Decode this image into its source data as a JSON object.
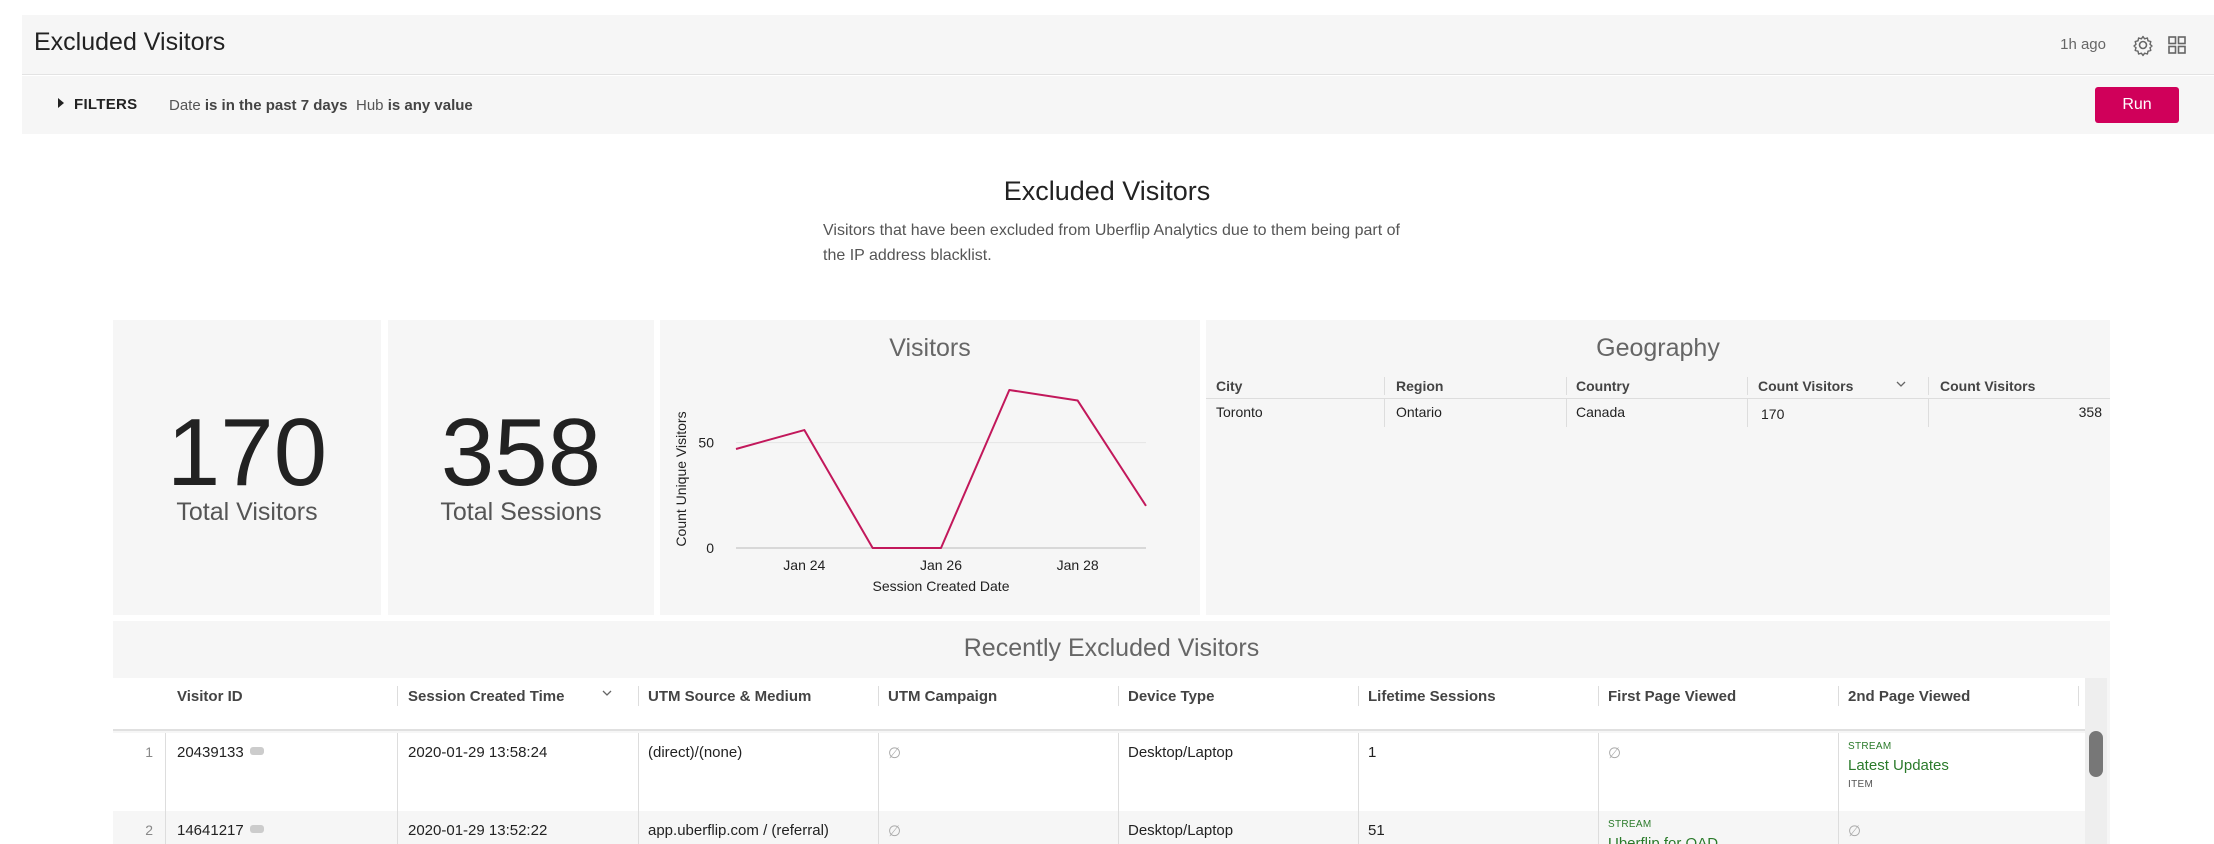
{
  "header": {
    "title": "Excluded Visitors",
    "last_updated": "1h ago",
    "icons": [
      "gear-icon",
      "grid-icon"
    ]
  },
  "filters": {
    "toggle_label": "FILTERS",
    "items": [
      {
        "field": "Date",
        "condition": "is in the past 7 days"
      },
      {
        "field": "Hub",
        "condition": "is any value"
      }
    ],
    "run_label": "Run"
  },
  "dashboard": {
    "title": "Excluded Visitors",
    "description": "Visitors that have been excluded from Uberflip Analytics due to them being part of the IP address blacklist."
  },
  "tiles": {
    "total_visitors": {
      "value": "170",
      "label": "Total Visitors"
    },
    "total_sessions": {
      "value": "358",
      "label": "Total Sessions"
    }
  },
  "chart_data": {
    "type": "line",
    "title": "Visitors",
    "xlabel": "Session Created Date",
    "ylabel": "Count Unique Visitors",
    "x": [
      "Jan 23",
      "Jan 24",
      "Jan 25",
      "Jan 26",
      "Jan 27",
      "Jan 28",
      "Jan 29"
    ],
    "x_tick_labels": [
      "Jan 24",
      "Jan 26",
      "Jan 28"
    ],
    "y_ticks": [
      0,
      50
    ],
    "ylim": [
      0,
      75
    ],
    "series": [
      {
        "values": [
          47,
          56,
          0,
          0,
          75,
          70,
          20
        ]
      }
    ],
    "colors": {
      "line": "#c2185b",
      "grid": "#e5e5e5"
    }
  },
  "geography": {
    "title": "Geography",
    "columns": [
      "City",
      "Region",
      "Country",
      "Count Visitors",
      "Count Visitors"
    ],
    "rows": [
      {
        "city": "Toronto",
        "region": "Ontario",
        "country": "Canada",
        "count_visitors": "170",
        "count_sessions": "358"
      }
    ]
  },
  "recent": {
    "title": "Recently Excluded Visitors",
    "columns": [
      "Visitor ID",
      "Session Created Time",
      "UTM Source & Medium",
      "UTM Campaign",
      "Device Type",
      "Lifetime Sessions",
      "First Page Viewed",
      "2nd Page Viewed"
    ],
    "null_symbol": "∅",
    "rows": [
      {
        "num": "1",
        "visitor_id": "20439133",
        "session_time": "2020-01-29 13:58:24",
        "utm_source": "(direct)/(none)",
        "device": "Desktop/Laptop",
        "lifetime_sessions": "1",
        "second_page": {
          "tag": "STREAM",
          "title": "Latest Updates",
          "sub": "ITEM"
        }
      },
      {
        "num": "2",
        "visitor_id": "14641217",
        "session_time": "2020-01-29 13:52:22",
        "utm_source": "app.uberflip.com / (referral)",
        "device": "Desktop/Laptop",
        "lifetime_sessions": "51",
        "first_page": {
          "tag": "STREAM",
          "title": "Uberflip for QAD"
        }
      }
    ]
  },
  "colors": {
    "accent": "#d0005a",
    "tile_bg": "#f6f6f6",
    "link_green": "#2a7a2a"
  }
}
